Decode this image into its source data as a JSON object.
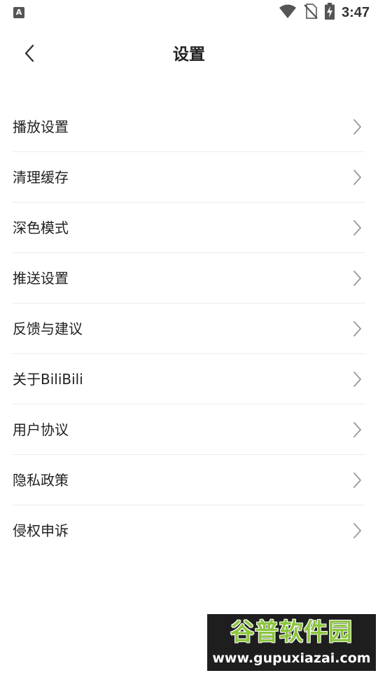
{
  "status_bar": {
    "notification_glyph": "A",
    "time": "3:47",
    "icons": [
      "wifi-icon",
      "no-sim-icon",
      "battery-charging-icon"
    ]
  },
  "header": {
    "back_icon": "chevron-left-icon",
    "title": "设置"
  },
  "settings": {
    "items": [
      {
        "label": "播放设置"
      },
      {
        "label": "清理缓存"
      },
      {
        "label": "深色模式"
      },
      {
        "label": "推送设置"
      },
      {
        "label": "反馈与建议"
      },
      {
        "label": "关于BiliBili"
      },
      {
        "label": "用户协议"
      },
      {
        "label": "隐私政策"
      },
      {
        "label": "侵权申诉"
      }
    ],
    "chevron_icon": "chevron-right-icon"
  },
  "watermark": {
    "brand": "谷普软件园",
    "url": "www.gupuxiazai.com"
  },
  "colors": {
    "text": "#222222",
    "divider": "#ececec",
    "chevron": "#999999",
    "watermark_green": "#8cc63e"
  }
}
